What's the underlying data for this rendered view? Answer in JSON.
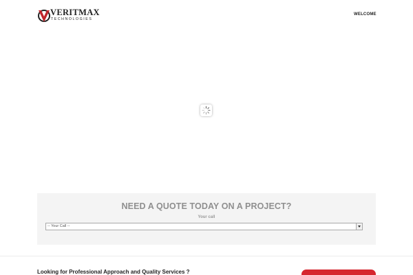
{
  "header": {
    "logo": {
      "brand": "VERITMAX",
      "subtitle": "TECHNOLOGIES"
    },
    "nav": {
      "welcome": "WELCOME"
    }
  },
  "hero": {
    "loading_icon": "spinner-icon"
  },
  "quote": {
    "title": "NEED A QUOTE TODAY ON A PROJECT?",
    "label": "Your call",
    "select_value": "-- Your Call --"
  },
  "cta": {
    "text": "Looking for Professional Approach and Quality Services ?",
    "button_label": ""
  },
  "colors": {
    "accent": "#d6262f",
    "logo_red": "#c0272d",
    "panel": "#f4f4f4"
  }
}
